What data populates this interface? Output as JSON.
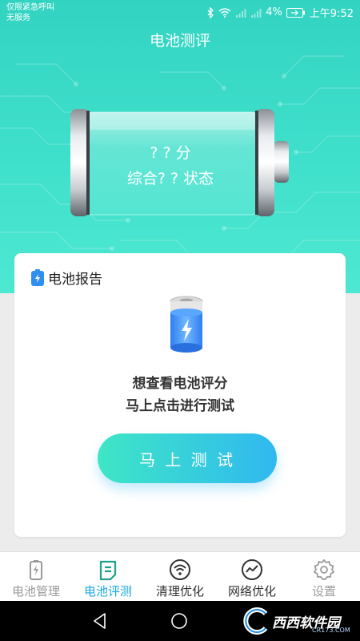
{
  "status_bar": {
    "line1": "仅限紧急呼叫",
    "line2": "无服务",
    "battery_percent": "4%",
    "time": "上午9:52"
  },
  "header": {
    "title": "电池测评"
  },
  "battery_display": {
    "score_text": "? ? 分",
    "status_text": "综合? ? 状态"
  },
  "report": {
    "title": "电池报告",
    "prompt_line1": "想查看电池评分",
    "prompt_line2": "马上点击进行测试",
    "test_button_label": "马 上 测 试"
  },
  "bottom_nav": {
    "items": [
      {
        "label": "电池管理",
        "icon": "battery-icon"
      },
      {
        "label": "电池评测",
        "icon": "report-icon",
        "active": true
      },
      {
        "label": "清理优化",
        "icon": "wifi-clean-icon"
      },
      {
        "label": "网络优化",
        "icon": "speed-icon"
      },
      {
        "label": "设置",
        "icon": "gear-icon"
      }
    ]
  },
  "watermark": {
    "text": "西西软件园",
    "url": "CR173.COM"
  },
  "colors": {
    "hero_teal": "#3fe0cb",
    "accent_blue": "#1aa9e2",
    "button_start": "#3ee6c6",
    "button_end": "#30b8f0"
  }
}
